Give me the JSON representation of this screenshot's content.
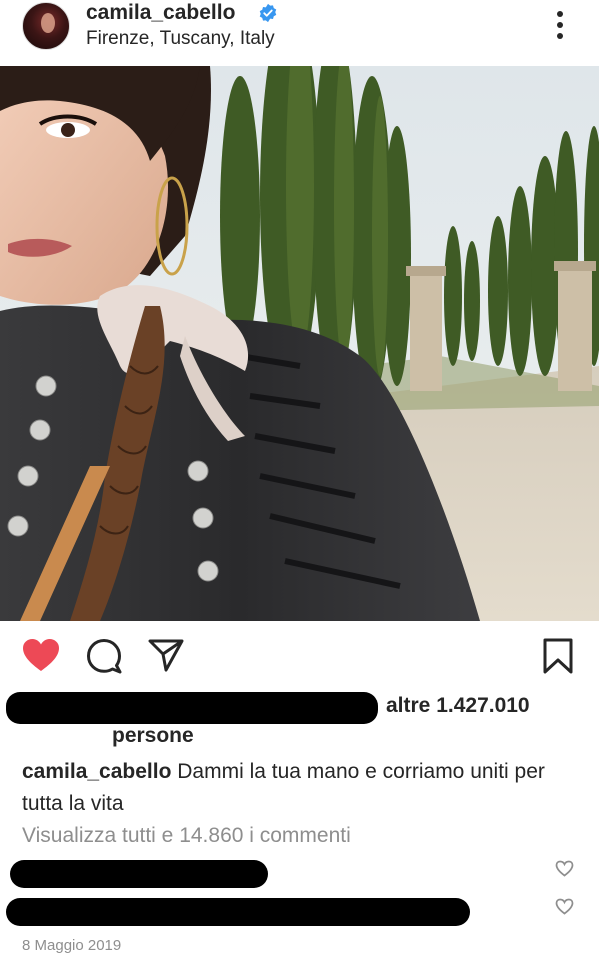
{
  "post": {
    "username": "camila_cabello",
    "location": "Firenze, Tuscany, Italy",
    "verified": true
  },
  "actions": {
    "liked": true,
    "like_color": "#ed4956",
    "icons": [
      "heart-icon",
      "comment-icon",
      "share-icon",
      "bookmark-icon"
    ]
  },
  "likes": {
    "text": "altre 1.427.010",
    "text2": "persone"
  },
  "caption": {
    "username": "camila_cabello",
    "text": "Dammi la tua mano e corriamo uniti per tutta la vita"
  },
  "comments": {
    "view_all": "Visualizza tutti e 14.860 i commenti"
  },
  "date": "8 Maggio 2019"
}
